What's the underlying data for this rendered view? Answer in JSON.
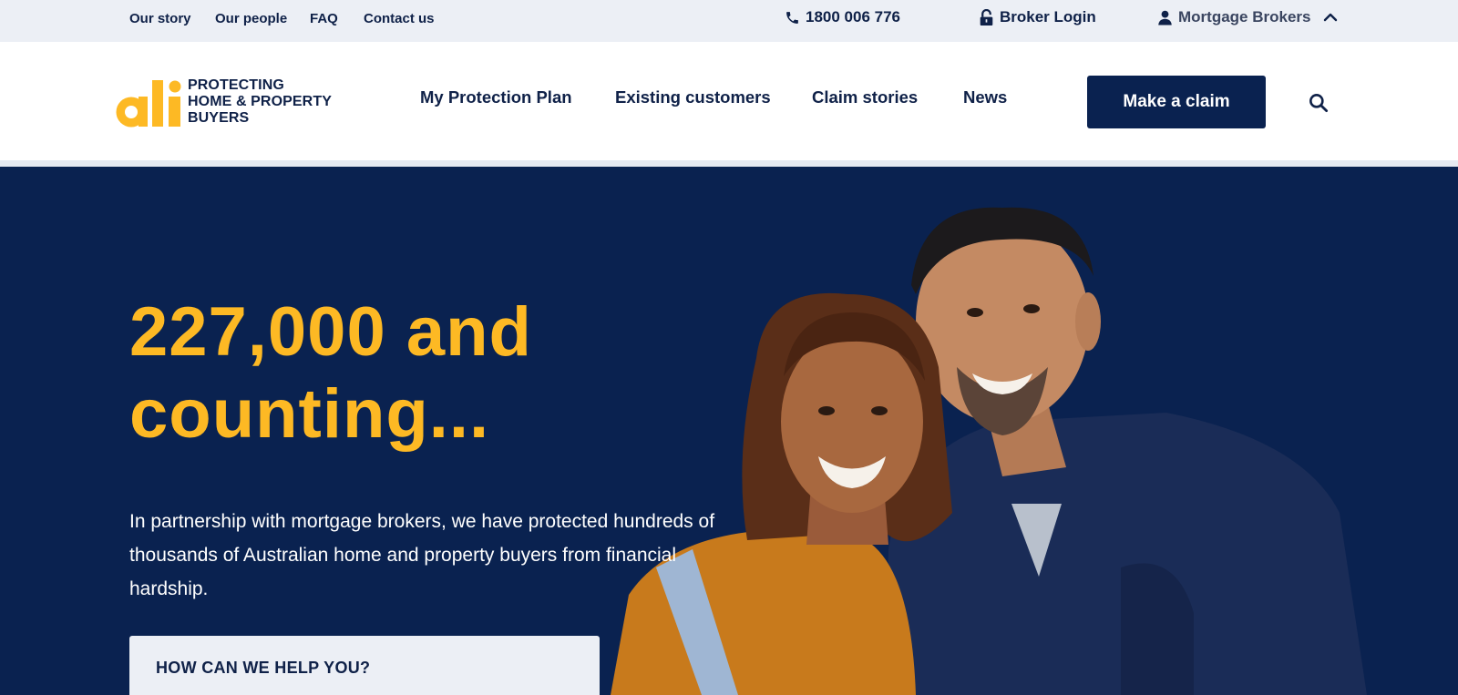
{
  "utility_nav": {
    "links": [
      "Our story",
      "Our people",
      "FAQ",
      "Contact us"
    ],
    "phone": "1800 006 776",
    "broker_login": "Broker Login",
    "audience_switch": "Mortgage Brokers"
  },
  "header": {
    "logo": {
      "wordmark": "ali",
      "tagline_lines": [
        "PROTECTING",
        "HOME & PROPERTY",
        "BUYERS"
      ]
    },
    "nav": [
      "My Protection Plan",
      "Existing customers",
      "Claim stories",
      "News"
    ],
    "cta_label": "Make a claim"
  },
  "hero": {
    "title_lines": [
      "227,000 and",
      "counting..."
    ],
    "body": "In partnership with mortgage brokers, we have protected hundreds of thousands of Australian home and property buyers from financial hardship.",
    "help_card_title": "HOW CAN WE HELP YOU?"
  },
  "icons": {
    "phone": "phone-icon",
    "lock": "lock-icon",
    "user": "user-icon",
    "chevron": "chevron-up-icon",
    "search": "search-icon"
  },
  "colors": {
    "navy": "#0a2250",
    "text_navy": "#0f2148",
    "accent_yellow": "#fdb924",
    "utility_bg": "#eceff5"
  }
}
